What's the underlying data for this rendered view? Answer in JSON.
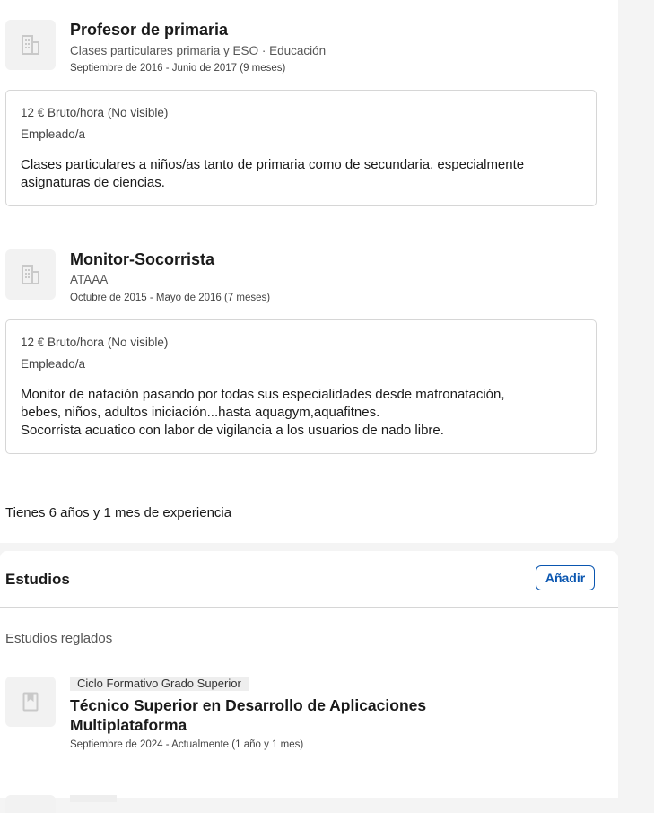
{
  "experience": [
    {
      "icon": "building-icon",
      "title": "Profesor de primaria",
      "company": "Clases particulares primaria y ESO · Educación",
      "dates": "Septiembre de 2016 - Junio de 2017 (9 meses)",
      "salary": "12 € Bruto/hora (No visible)",
      "type": "Empleado/a",
      "description": "Clases particulares a niños/as tanto de primaria como de secundaria, especialmente asignaturas de ciencias."
    },
    {
      "icon": "building-icon",
      "title": "Monitor-Socorrista",
      "company": "ATAAA",
      "dates": "Octubre de 2015 - Mayo de 2016 (7 meses)",
      "salary": "12 € Bruto/hora (No visible)",
      "type": "Empleado/a",
      "description_lines": [
        "Monitor de natación pasando por todas sus especialidades desde matronatación,",
        "bebes, niños, adultos iniciación...hasta aquagym,aquafitnes.",
        "Socorrista acuatico con labor de vigilancia a los usuarios de nado libre."
      ]
    }
  ],
  "experience_summary": "Tienes 6 años y 1 mes de experiencia",
  "education": {
    "title": "Estudios",
    "add_label": "Añadir",
    "subsection": "Estudios reglados",
    "items": [
      {
        "icon": "book-icon",
        "level": "Ciclo Formativo Grado Superior",
        "title": "Técnico Superior en Desarrollo de Aplicaciones Multiplataforma",
        "dates": "Septiembre de 2024 - Actualmente (1 año y 1 mes)"
      }
    ]
  },
  "colors": {
    "accent": "#0a56b0",
    "border": "#d6d6d6",
    "icon_bg": "#f2f2f2"
  }
}
